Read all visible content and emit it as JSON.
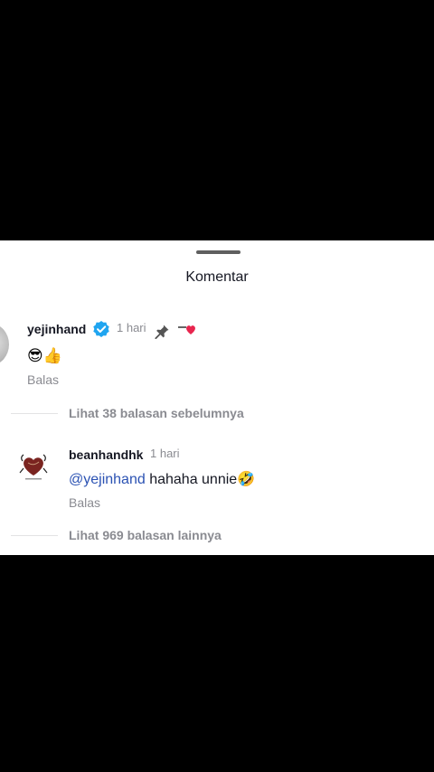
{
  "sheet": {
    "title": "Komentar"
  },
  "comments": [
    {
      "username": "yejinhand",
      "verified": true,
      "time": "1 hari",
      "pinned": true,
      "text": "😎👍",
      "reply_label": "Balas",
      "view_replies": "Lihat 38 balasan sebelumnya"
    },
    {
      "username": "beanhandhk",
      "time": "1 hari",
      "mention": "@yejinhand",
      "text": " hahaha unnie🤣",
      "reply_label": "Balas",
      "view_replies": "Lihat 969 balasan lainnya"
    }
  ],
  "colors": {
    "mention": "#2b52b3",
    "verified": "#20a5f0",
    "heart": "#e8254e"
  }
}
